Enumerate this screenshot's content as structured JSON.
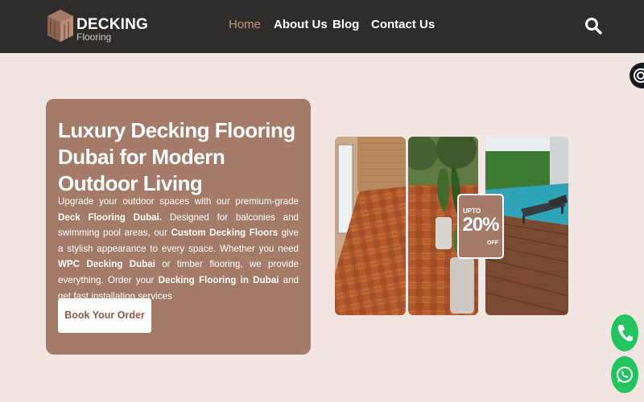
{
  "brand": {
    "name": "DECKING",
    "sub": "Flooring"
  },
  "nav": [
    {
      "label": "Home",
      "active": true
    },
    {
      "label": "About Us",
      "active": false
    },
    {
      "label": "Blog",
      "active": false
    },
    {
      "label": "Contact Us",
      "active": false
    }
  ],
  "header": {
    "search_icon": "search-icon"
  },
  "hero": {
    "title": "Luxury Decking Flooring Dubai for Modern Outdoor Living",
    "desc": {
      "t1": "Upgrade your outdoor spaces with our premium-grade ",
      "b1": "Deck Flooring Dubai.",
      "t2": " Designed for balconies and swimming pool areas, our ",
      "b2": "Custom Decking Floors",
      "t3": " give a stylish appearance to every space. Whether you need ",
      "b3": "WPC Decking Dubai",
      "t4": " or timber flooring, we provide everything. Order your ",
      "b4": "Decking Flooring in Dubai",
      "t5": " and get fast installation services"
    },
    "button": "Book Your Order"
  },
  "promo": {
    "upto": "UPTO",
    "percent": "20%",
    "off": "OFF"
  },
  "colors": {
    "header": "#2f2d2b",
    "accent": "#a47a69",
    "background": "#f2e6e3",
    "fab": "#22c45e"
  },
  "icons": {
    "call": "phone-icon",
    "chat": "whatsapp-icon",
    "widget": "accessibility-icon"
  }
}
